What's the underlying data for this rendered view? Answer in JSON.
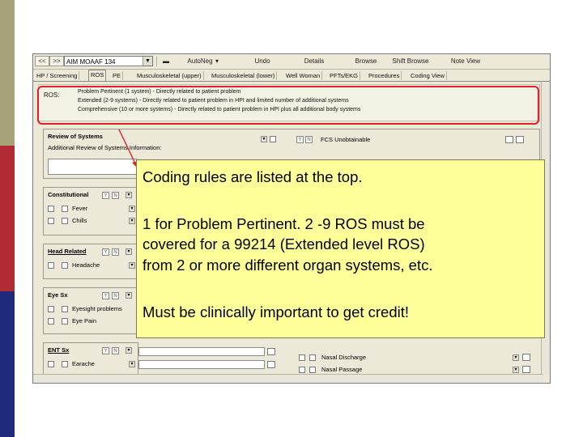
{
  "toolbar": {
    "nav_back": "<<",
    "nav_forward": ">>",
    "combo_value": "AIM MOAAF 134",
    "buttons": [
      "AutoNeg",
      "Undo",
      "Details",
      "Browse",
      "Shift Browse",
      "Note View"
    ]
  },
  "tabs": [
    "HP / Screening",
    "ROS",
    "PE",
    "Musculoskeletal (upper)",
    "Musculoskeletal (lower)",
    "Well Woman",
    "PFTs/EKG",
    "Procedures",
    "Coding View"
  ],
  "ros_info": {
    "label": "ROS:",
    "lines": [
      "Problem Pertinent (1 system) - Directly related to patient problem",
      "Extended (2-9 systems) - Directly related to patient problem in HPI and limited number of additional systems",
      "Comprehensive (10 or more systems) - Directly related to patient problem in HPI plus all additional body systems"
    ]
  },
  "review": {
    "title": "Review of Systems",
    "additional_label": "Additional Review of Systems Information:",
    "y": "Y",
    "n": "N",
    "fcs_label": "FCS Unobtainable"
  },
  "sections": [
    {
      "title": "Constitutional",
      "items": [
        "Fever",
        "Chills"
      ]
    },
    {
      "title": "Head Related",
      "items": [
        "Headache"
      ]
    },
    {
      "title": "Eye Sx",
      "items": [
        "Eyesight problems",
        "Eye Pain"
      ]
    },
    {
      "title": "ENT Sx",
      "items": [
        "Earache"
      ]
    }
  ],
  "right_items": [
    "Nasal Discharge",
    "Nasal Passage"
  ],
  "callout": {
    "line1": "Coding rules are listed at the top.",
    "line2": "1 for Problem Pertinent.  2 -9 ROS must be",
    "line3": "covered for a 99214 (Extended level ROS)",
    "line4": "from 2 or more different organ systems, etc.",
    "line5": "Must be clinically important to get credit!"
  },
  "colors": {
    "callout_bg": "#ffff99",
    "highlight": "#e0202a",
    "bar_olive": "#a6a37a",
    "bar_red": "#b22a33",
    "bar_navy": "#1f2a7a"
  }
}
